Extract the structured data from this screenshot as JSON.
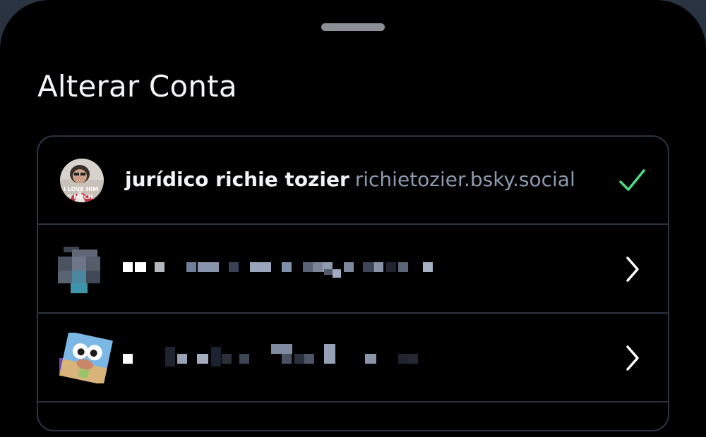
{
  "sheet": {
    "title": "Alterar Conta"
  },
  "accounts": [
    {
      "display_name": "jurídico richie tozier",
      "handle": "richietozier.bsky.social",
      "avatar_text": "I LOVE HIM SO MUCH",
      "selected": true,
      "trailing_icon": "check-icon"
    },
    {
      "display_name": "",
      "handle": "",
      "redacted": true,
      "selected": false,
      "trailing_icon": "chevron-right-icon"
    },
    {
      "display_name": "",
      "handle": "",
      "redacted": true,
      "selected": false,
      "trailing_icon": "chevron-right-icon"
    }
  ],
  "colors": {
    "background": "#000000",
    "row_border": "#2c3442",
    "title": "#f2f4f7",
    "handle": "#8d9bb0",
    "check": "#4ade80",
    "chevron": "#ffffff"
  }
}
